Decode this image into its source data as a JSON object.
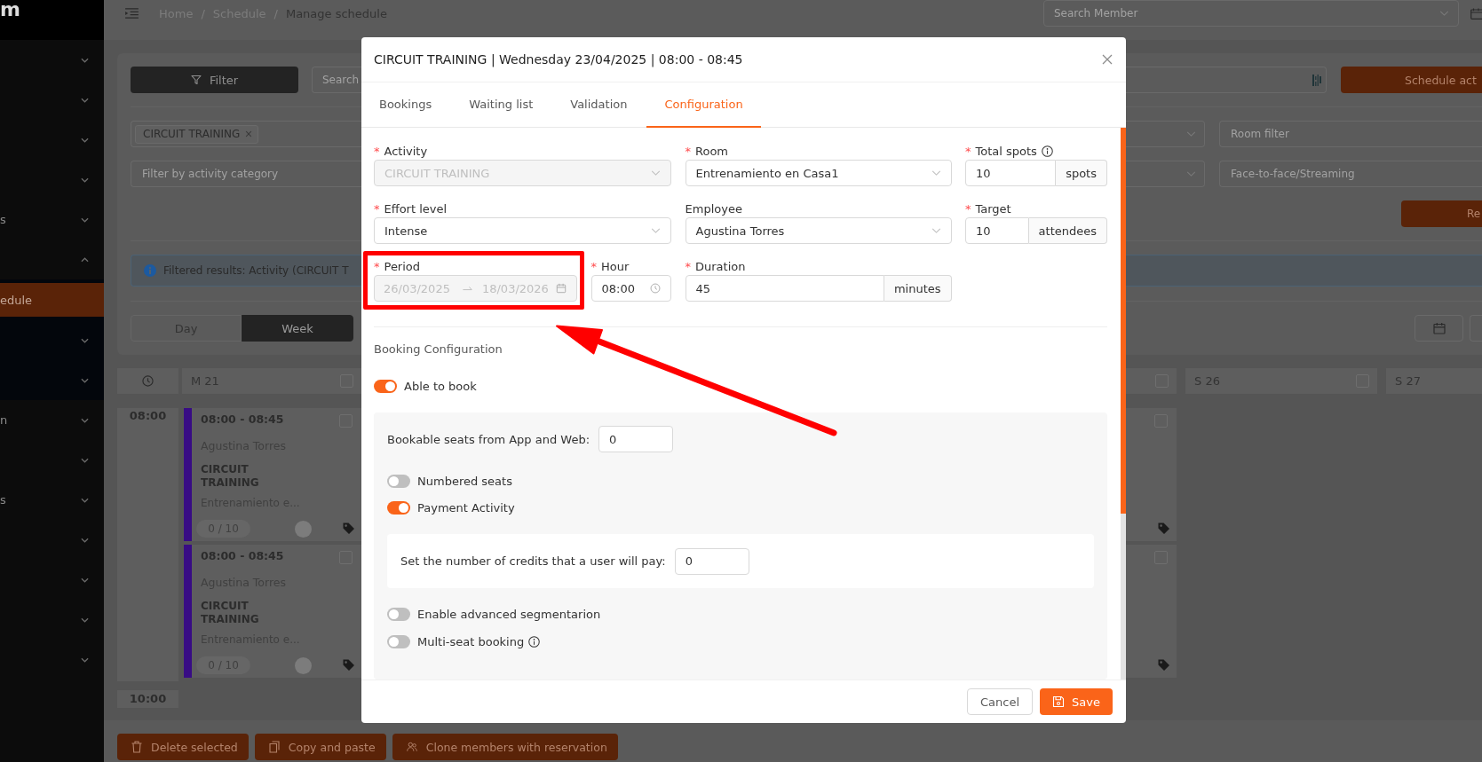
{
  "sidebar": {
    "logo": "m",
    "items": [
      {
        "kind": "group",
        "expanded": false,
        "selected": false
      },
      {
        "kind": "group",
        "expanded": false,
        "selected": false
      },
      {
        "kind": "group",
        "expanded": false,
        "selected": false
      },
      {
        "kind": "group",
        "expanded": false,
        "selected": false
      },
      {
        "kind": "group",
        "label": "s",
        "expanded": false,
        "selected": false
      },
      {
        "kind": "group",
        "expanded": true,
        "selected": false,
        "children": [
          {
            "kind": "link",
            "label": "edule",
            "selected": true
          },
          {
            "kind": "group",
            "expanded": false,
            "selected": false
          },
          {
            "kind": "group",
            "expanded": false,
            "selected": false
          }
        ]
      },
      {
        "kind": "group",
        "label": "n",
        "expanded": false,
        "selected": false
      },
      {
        "kind": "group",
        "expanded": false,
        "selected": false
      },
      {
        "kind": "group",
        "label": "s",
        "expanded": false,
        "selected": false
      },
      {
        "kind": "group",
        "expanded": false,
        "selected": false
      },
      {
        "kind": "group",
        "expanded": false,
        "selected": false
      },
      {
        "kind": "group",
        "expanded": false,
        "selected": false
      },
      {
        "kind": "group",
        "expanded": false,
        "selected": false
      }
    ]
  },
  "header": {
    "breadcrumb": [
      {
        "label": "Home",
        "separator": "/",
        "current": false
      },
      {
        "label": "Schedule",
        "separator": "/",
        "current": false
      },
      {
        "label": "Manage schedule",
        "current": true
      }
    ],
    "member_search": {
      "placeholder": "Search Member"
    }
  },
  "filters": {
    "filter_button": "Filter",
    "search": {
      "placeholder": "Search"
    },
    "schedule_button": "Schedule act",
    "activity_select": {
      "tags": [
        "CIRCUIT TRAINING"
      ]
    },
    "room_filter": {
      "placeholder": "Room filter"
    },
    "category_select": {
      "placeholder": "Filter by activity category"
    },
    "mode_filter": {
      "placeholder": "Face-to-face/Streaming"
    },
    "action_button": "Re",
    "alert": "Filtered results: Activity (CIRCUIT T",
    "views": [
      {
        "label": "Day",
        "selected": false
      },
      {
        "label": "Week",
        "selected": true
      }
    ]
  },
  "calendar": {
    "times": [
      "08:00",
      "10:00"
    ],
    "columns": [
      {
        "label": "M 21",
        "checked": false,
        "events": [
          {
            "time": "08:00 - 08:45",
            "employee": "Agustina Torres",
            "activity": "CIRCUIT TRAINING",
            "room": "Entrenamiento e...",
            "occupancy": "0 / 10",
            "color": "#380c84",
            "checked": false
          },
          {
            "time": "08:00 - 08:45",
            "employee": "Agustina Torres",
            "activity": "CIRCUIT TRAINING",
            "room": "Entrenamiento e...",
            "occupancy": "0 / 10",
            "color": "#380c84",
            "checked": false
          }
        ]
      },
      {
        "checked": false,
        "events": [
          {
            "checked": false
          },
          {
            "checked": false
          }
        ]
      },
      {
        "label": "S 26",
        "checked": false
      },
      {
        "label": "S 27"
      }
    ]
  },
  "actions": [
    {
      "label": "Delete selected"
    },
    {
      "label": "Copy and paste"
    },
    {
      "label": "Clone members with reservation"
    }
  ],
  "modal": {
    "title": "CIRCUIT TRAINING | Wednesday 23/04/2025 | 08:00 - 08:45",
    "tabs": [
      {
        "label": "Bookings",
        "selected": false
      },
      {
        "label": "Waiting list",
        "selected": false
      },
      {
        "label": "Validation",
        "selected": false
      },
      {
        "label": "Configuration",
        "selected": true
      }
    ],
    "rows": [
      [
        {
          "kind": "select",
          "required_mark": "*",
          "label": "Activity",
          "value": "CIRCUIT TRAINING",
          "disabled": true
        },
        {
          "kind": "select",
          "required_mark": "*",
          "label": "Room",
          "value": "Entrenamiento en Casa1",
          "disabled": false
        },
        {
          "kind": "number",
          "required_mark": "*",
          "label": "Total spots",
          "info_icon": true,
          "value": "10",
          "unit": "spots"
        }
      ],
      [
        {
          "kind": "select",
          "required_mark": "*",
          "label": "Effort level",
          "value": "Intense",
          "disabled": false
        },
        {
          "kind": "select",
          "label": "Employee",
          "value": "Agustina Torres",
          "disabled": false
        },
        {
          "kind": "number",
          "required_mark": "*",
          "label": "Target",
          "value": "10",
          "unit": "attendees"
        }
      ],
      [
        {
          "kind": "pair",
          "fields": [
            {
              "kind": "date_range",
              "required_mark": "*",
              "label": "Period",
              "start": "26/03/2025",
              "end": "18/03/2026",
              "disabled": true,
              "annotated": true
            },
            {
              "kind": "time",
              "required_mark": "*",
              "label": "Hour",
              "value": "08:00"
            }
          ]
        },
        {
          "kind": "number",
          "required_mark": "*",
          "label": "Duration",
          "value": "45",
          "unit": "minutes"
        }
      ]
    ],
    "booking": {
      "heading": "Booking Configuration",
      "able_to_book": {
        "label": "Able to book",
        "on": true
      },
      "seats": {
        "label": "Bookable seats from App and Web:",
        "value": "0"
      },
      "toggles": [
        {
          "label": "Numbered seats",
          "on": false
        },
        {
          "label": "Payment Activity",
          "on": true
        }
      ],
      "credits": {
        "label": "Set the number of credits that a user will pay:",
        "value": "0"
      },
      "extra_toggles": [
        {
          "label": "Enable advanced segmentarion",
          "on": false
        },
        {
          "label": "Multi-seat booking",
          "on": false,
          "info_icon": true
        }
      ]
    },
    "buttons": [
      {
        "kind": "default",
        "label": "Cancel"
      },
      {
        "kind": "primary",
        "label": "Save"
      }
    ]
  }
}
